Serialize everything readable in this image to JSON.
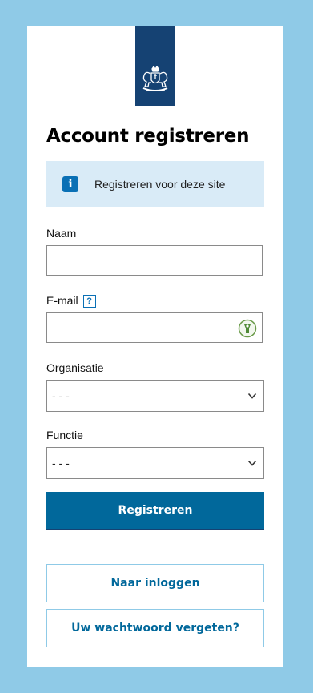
{
  "header": {
    "logo": "rijksoverheid-coat-of-arms"
  },
  "form": {
    "title": "Account registreren",
    "info_text": "Registreren voor deze site",
    "name_label": "Naam",
    "name_value": "",
    "email_label": "E-mail",
    "email_help": "?",
    "email_value": "",
    "organisation_label": "Organisatie",
    "organisation_value": "- - -",
    "function_label": "Functie",
    "function_value": "- - -",
    "submit_label": "Registreren",
    "login_link": "Naar inloggen",
    "forgot_link": "Uw wachtwoord vergeten?"
  },
  "colors": {
    "page_background": "#8fcae7",
    "brand_dark": "#154273",
    "primary_button": "#01689b",
    "info_background": "#d9ebf7",
    "info_icon": "#0a70b5"
  }
}
